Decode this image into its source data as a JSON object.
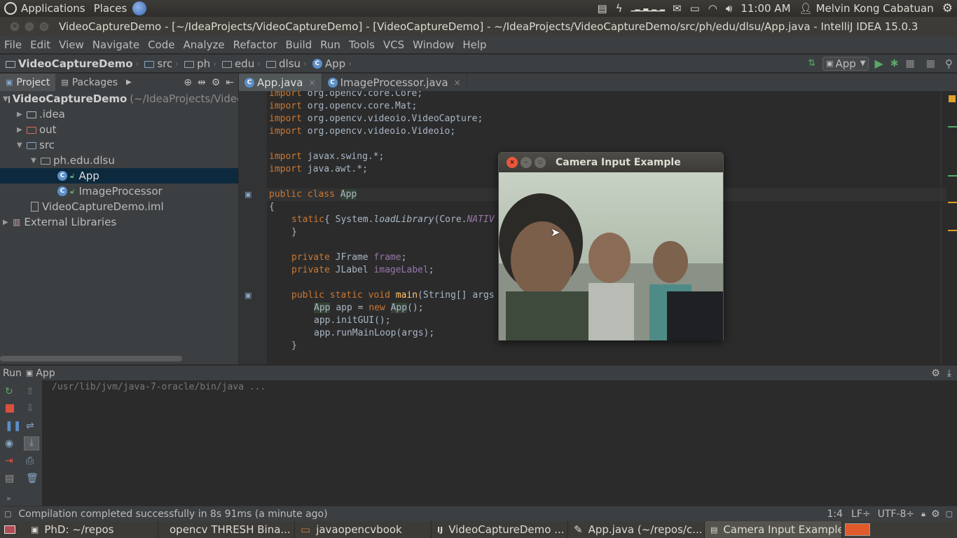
{
  "top_panel": {
    "applications": "Applications",
    "places": "Places",
    "clock": "11:00 AM",
    "user": "Melvin Kong Cabatuan"
  },
  "window": {
    "title": "VideoCaptureDemo - [~/IdeaProjects/VideoCaptureDemo] - [VideoCaptureDemo] - ~/IdeaProjects/VideoCaptureDemo/src/ph/edu/dlsu/App.java - IntelliJ IDEA 15.0.3"
  },
  "menu": [
    "File",
    "Edit",
    "View",
    "Navigate",
    "Code",
    "Analyze",
    "Refactor",
    "Build",
    "Run",
    "Tools",
    "VCS",
    "Window",
    "Help"
  ],
  "breadcrumb": [
    "VideoCaptureDemo",
    "src",
    "ph",
    "edu",
    "dlsu",
    "App"
  ],
  "run_config": "App",
  "project_panel": {
    "tabs": [
      "Project",
      "Packages"
    ],
    "tree": [
      {
        "label": "VideoCaptureDemo",
        "suffix": "(~/IdeaProjects/VideoC"
      },
      {
        "label": ".idea"
      },
      {
        "label": "out"
      },
      {
        "label": "src"
      },
      {
        "label": "ph.edu.dlsu"
      },
      {
        "label": "App"
      },
      {
        "label": "ImageProcessor"
      },
      {
        "label": "VideoCaptureDemo.iml"
      },
      {
        "label": "External Libraries"
      }
    ]
  },
  "editor_tabs": [
    "App.java",
    "ImageProcessor.java"
  ],
  "code_lines": [
    "import org.opencv.core.Core;",
    "import org.opencv.core.Mat;",
    "import org.opencv.videoio.VideoCapture;",
    "import org.opencv.videoio.Videoio;",
    "import javax.swing.*;",
    "import java.awt.*;",
    "public class App",
    "{",
    "static{ System.loadLibrary(Core.NATIV",
    "}",
    "private JFrame frame;",
    "private JLabel imageLabel;",
    "public static void main(String[] args",
    "App app = new App();",
    "app.initGUI();",
    "app.runMainLoop(args);",
    "}"
  ],
  "camera_window": {
    "title": "Camera Input Example"
  },
  "run_panel": {
    "label": "Run",
    "config": "App",
    "console": "/usr/lib/jvm/java-7-oracle/bin/java ..."
  },
  "status": {
    "message": "Compilation completed successfully in 8s 91ms (a minute ago)",
    "position": "1:4",
    "line_sep": "LF÷",
    "encoding": "UTF-8÷"
  },
  "taskbar": [
    "PhD: ~/repos",
    "opencv THRESH Bina...",
    "javaopencvbook",
    "VideoCaptureDemo ...",
    "App.java (~/repos/c...",
    "Camera Input Example"
  ],
  "colors": {
    "editor_bg": "#2b2b2b",
    "panel_bg": "#3c3f41",
    "keyword": "#cc7832",
    "selection": "#0d293e"
  }
}
